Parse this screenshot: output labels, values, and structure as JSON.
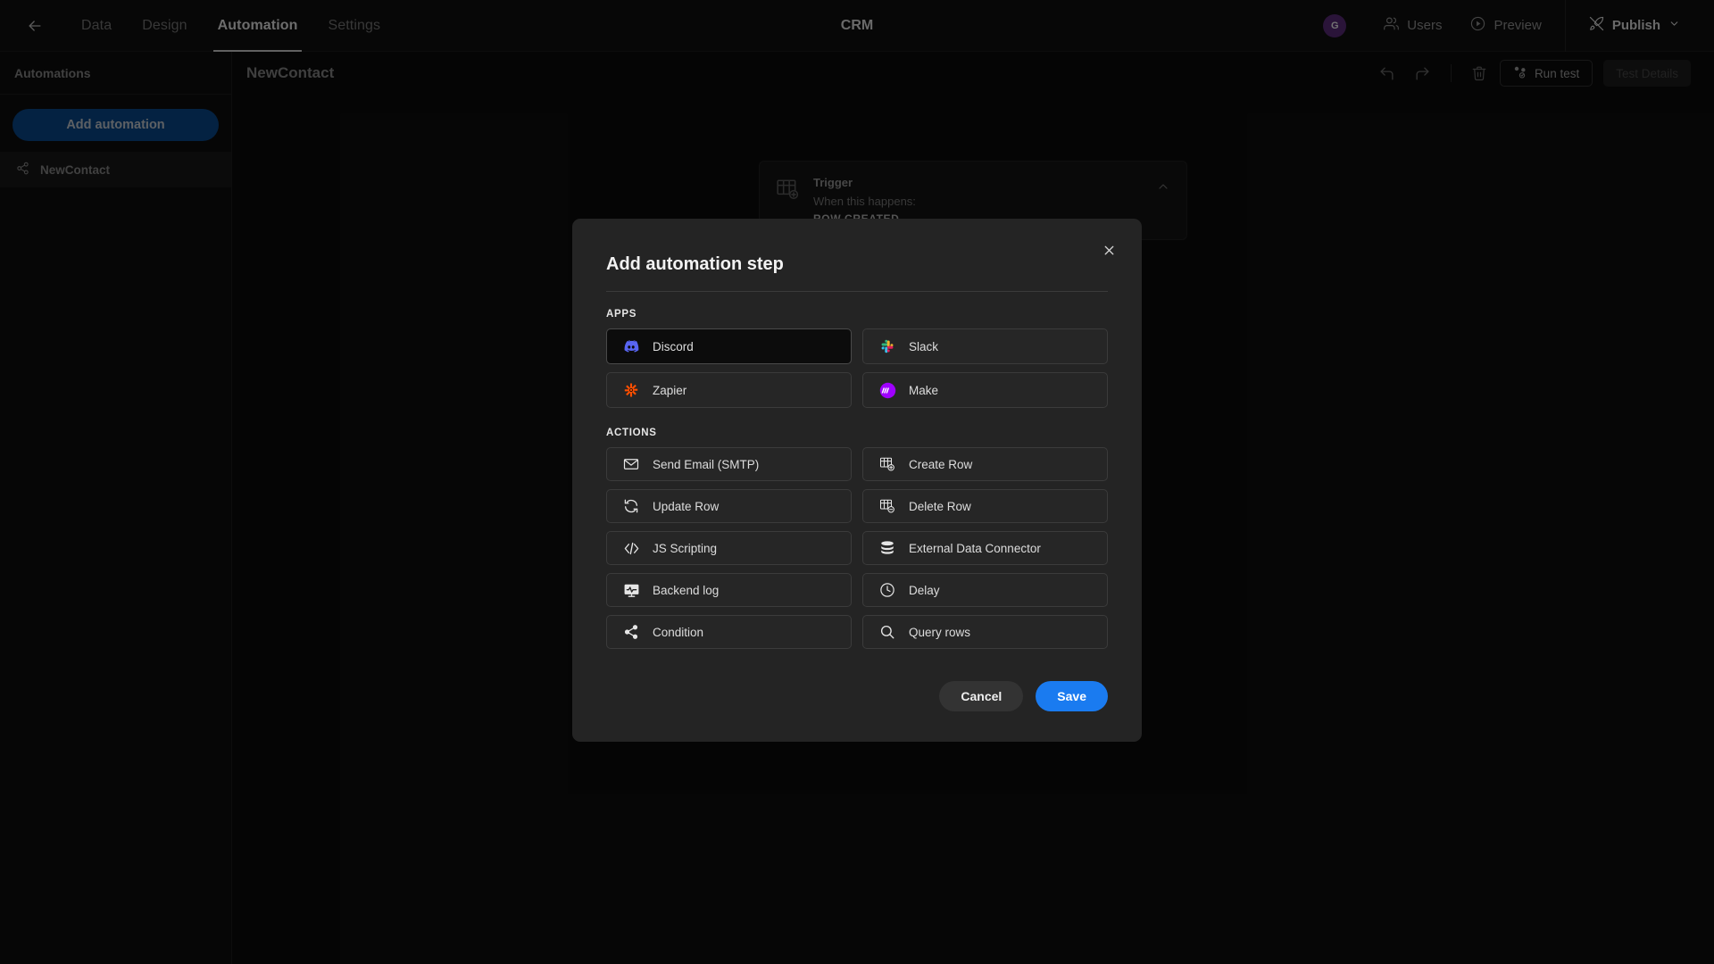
{
  "topbar": {
    "back_icon": "back-arrow-icon",
    "tabs": [
      {
        "label": "Data",
        "active": false
      },
      {
        "label": "Design",
        "active": false
      },
      {
        "label": "Automation",
        "active": true
      },
      {
        "label": "Settings",
        "active": false
      }
    ],
    "app_title": "CRM",
    "avatar_initial": "G",
    "users_label": "Users",
    "preview_label": "Preview",
    "publish_label": "Publish"
  },
  "sidebar": {
    "header": "Automations",
    "add_button": "Add automation",
    "items": [
      {
        "label": "NewContact",
        "icon": "share-nodes-icon"
      }
    ]
  },
  "main": {
    "page_title": "NewContact",
    "run_test_label": "Run test",
    "test_details_label": "Test Details",
    "undo_icon": "undo-icon",
    "redo_icon": "redo-icon",
    "delete_icon": "trash-icon"
  },
  "flow": {
    "trigger_label": "Trigger",
    "trigger_sub": "When this happens:",
    "trigger_value": "ROW CREATED",
    "collapse_icon": "chevron-up-icon",
    "connector_icon": "chevron-down-icon"
  },
  "modal": {
    "title": "Add automation step",
    "close_icon": "close-icon",
    "apps_label": "APPS",
    "actions_label": "ACTIONS",
    "apps": [
      {
        "label": "Discord",
        "icon": "discord-icon",
        "selected": true
      },
      {
        "label": "Slack",
        "icon": "slack-icon",
        "selected": false
      },
      {
        "label": "Zapier",
        "icon": "zapier-icon",
        "selected": false
      },
      {
        "label": "Make",
        "icon": "make-icon",
        "selected": false
      }
    ],
    "actions": [
      {
        "label": "Send Email (SMTP)",
        "icon": "envelope-icon"
      },
      {
        "label": "Create Row",
        "icon": "create-row-icon"
      },
      {
        "label": "Update Row",
        "icon": "refresh-icon"
      },
      {
        "label": "Delete Row",
        "icon": "delete-row-icon"
      },
      {
        "label": "JS Scripting",
        "icon": "code-icon"
      },
      {
        "label": "External Data Connector",
        "icon": "database-icon"
      },
      {
        "label": "Backend log",
        "icon": "monitor-activity-icon"
      },
      {
        "label": "Delay",
        "icon": "clock-icon"
      },
      {
        "label": "Condition",
        "icon": "share-nodes-icon"
      },
      {
        "label": "Query rows",
        "icon": "magnifier-icon"
      }
    ],
    "cancel_label": "Cancel",
    "save_label": "Save"
  },
  "colors": {
    "accent": "#1a7bf0",
    "sidebar_button": "#0b4d93",
    "discord": "#5865F2",
    "zapier": "#FF4F00",
    "make": "#9F00FF",
    "avatar": "#5d2d7e"
  }
}
